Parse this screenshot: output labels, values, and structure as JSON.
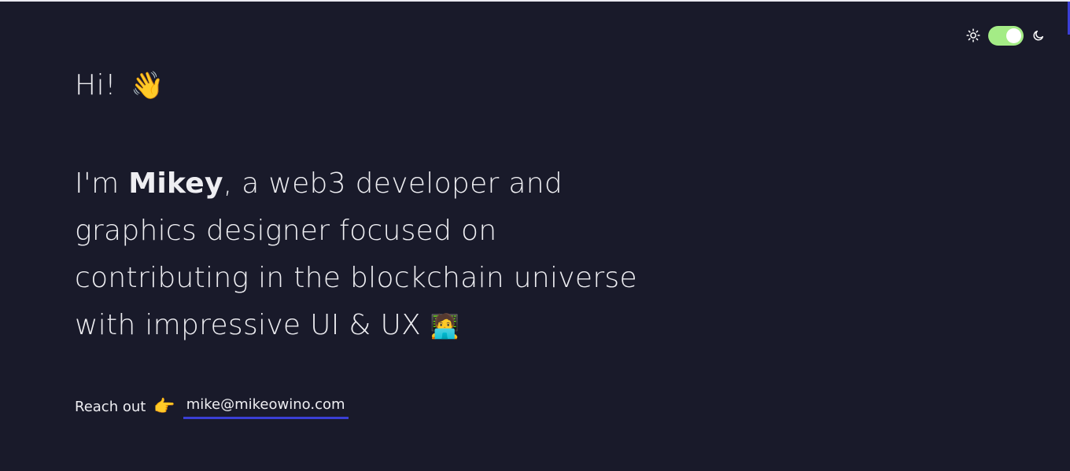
{
  "header": {
    "theme_toggle": {
      "light_icon": "sun-icon",
      "dark_icon": "moon-icon",
      "state": "on",
      "track_color": "#a4ec86"
    }
  },
  "hero": {
    "greeting": "Hi!",
    "greeting_emoji": "👋",
    "intro_prefix": "I'm",
    "name": "Mikey",
    "intro_suffix": ", a web3 developer and graphics designer focused on contributing in the blockchain universe with impressive UI & UX",
    "intro_emoji": "🧑‍💻"
  },
  "contact": {
    "label": "Reach out",
    "pointer_emoji": "👉",
    "email": "mike@mikeowino.com"
  },
  "colors": {
    "background": "#191a2a",
    "text": "#eeeef2",
    "accent": "#3b3fd6"
  }
}
